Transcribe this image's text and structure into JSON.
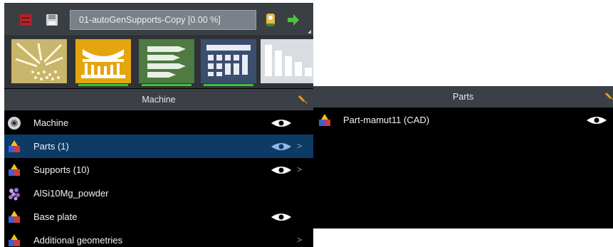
{
  "toolbar": {
    "title": "01-autoGenSupports-Copy [0.00 %]",
    "icons": [
      "stop-icon",
      "save-icon",
      "run-icon",
      "next-arrow-icon"
    ]
  },
  "tiles": [
    {
      "name": "tile-exposure",
      "icon": "laser-beam-icon",
      "active": false,
      "indicator": false
    },
    {
      "name": "tile-supports",
      "icon": "supports-icon",
      "active": true,
      "indicator": true
    },
    {
      "name": "tile-job",
      "icon": "list-icon",
      "active": false,
      "indicator": true
    },
    {
      "name": "tile-build",
      "icon": "build-layout-icon",
      "active": false,
      "indicator": true
    },
    {
      "name": "tile-slices",
      "icon": "slices-icon",
      "active": false,
      "indicator": false
    }
  ],
  "left_panel": {
    "header": "Machine",
    "items": [
      {
        "label": "Machine",
        "icon": "disc-icon",
        "eye": true,
        "chevron": false,
        "selected": false
      },
      {
        "label": "Parts (1)",
        "icon": "parts-icon",
        "eye": true,
        "chevron": true,
        "selected": true
      },
      {
        "label": "Supports (10)",
        "icon": "parts-icon",
        "eye": true,
        "chevron": true,
        "selected": false
      },
      {
        "label": "AlSi10Mg_powder",
        "icon": "powder-icon",
        "eye": false,
        "chevron": false,
        "selected": false
      },
      {
        "label": "Base plate",
        "icon": "parts-icon",
        "eye": true,
        "chevron": false,
        "selected": false
      },
      {
        "label": "Additional geometries",
        "icon": "parts-icon",
        "eye": false,
        "chevron": true,
        "selected": false
      }
    ]
  },
  "right_panel": {
    "header": "Parts",
    "items": [
      {
        "label": "Part-mamut11 (CAD)",
        "icon": "parts-icon",
        "eye": true
      }
    ]
  },
  "glyphs": {
    "chevron": ">"
  },
  "colors": {
    "accent_green": "#3fbf3f",
    "selected_row": "#0e3a66",
    "panel_header": "#3b4047",
    "pin_orange": "#f0a020"
  }
}
